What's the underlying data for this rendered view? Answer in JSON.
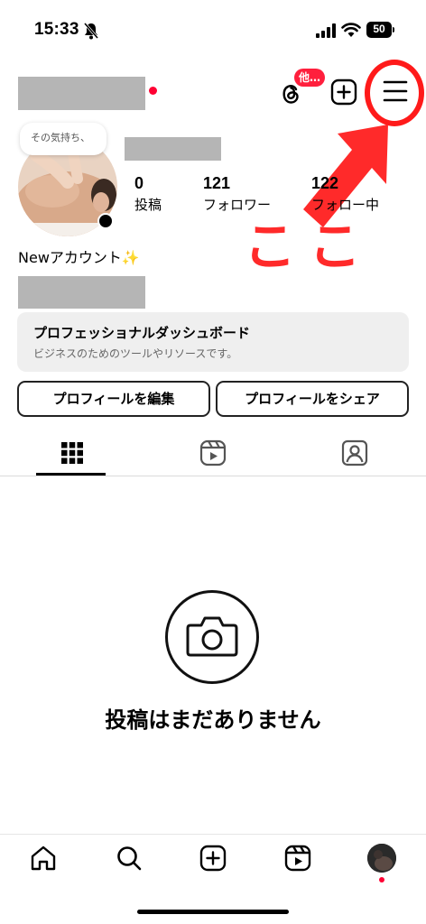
{
  "status_bar": {
    "time": "15:33",
    "battery": "50"
  },
  "header": {
    "threads_badge": "他…",
    "annotation_text": "ここ"
  },
  "profile": {
    "note": "その気持ち、",
    "stats": [
      {
        "count": "0",
        "label": "投稿"
      },
      {
        "count": "121",
        "label": "フォロワー"
      },
      {
        "count": "122",
        "label": "フォロー中"
      }
    ],
    "bio": "Newアカウント✨"
  },
  "dashboard": {
    "title": "プロフェッショナルダッシュボード",
    "subtitle": "ビジネスのためのツールやリソースです。"
  },
  "buttons": {
    "edit_profile": "プロフィールを編集",
    "share_profile": "プロフィールをシェア"
  },
  "tabs": [
    {
      "icon": "grid-icon",
      "active": true
    },
    {
      "icon": "reels-icon",
      "active": false
    },
    {
      "icon": "tagged-icon",
      "active": false
    }
  ],
  "empty_state": {
    "icon": "camera-icon",
    "text": "投稿はまだありません"
  },
  "bottom_nav": [
    "home-icon",
    "search-icon",
    "create-icon",
    "reels-icon",
    "profile-avatar"
  ],
  "colors": {
    "annotation_red": "#ff1a1a",
    "notification_red": "#ff0033",
    "dashboard_bg": "#efefef"
  }
}
